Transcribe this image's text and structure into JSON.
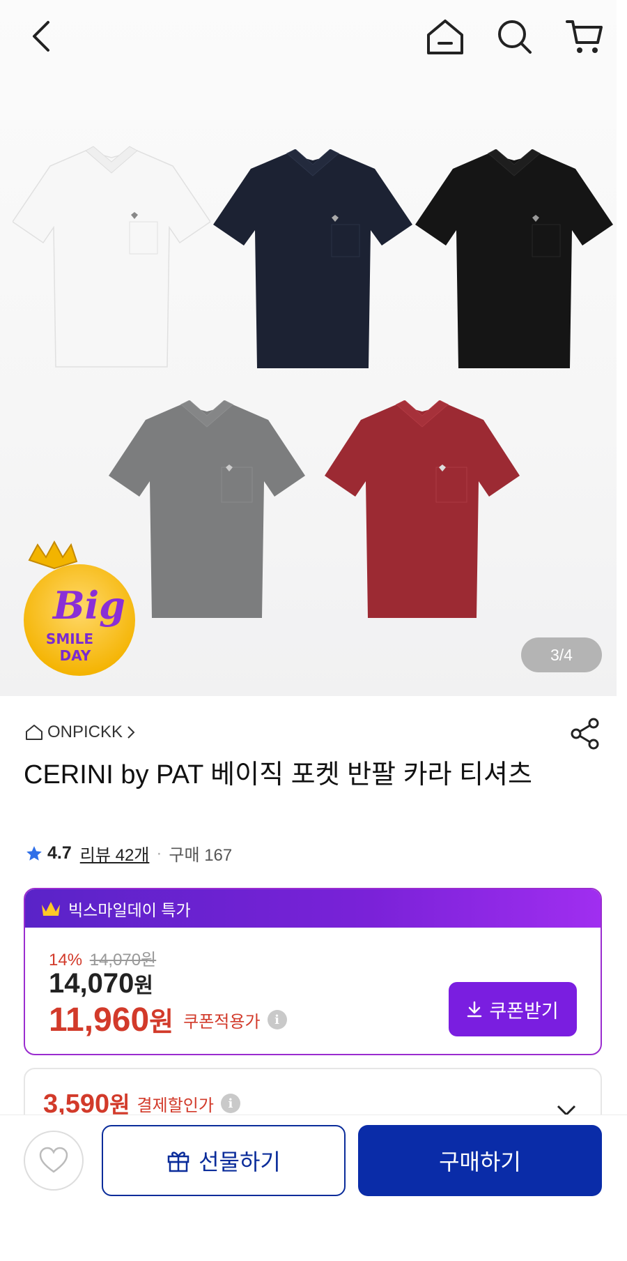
{
  "header": {
    "back_icon": "chevron-left-icon",
    "home_icon": "home-icon",
    "search_icon": "search-icon",
    "cart_icon": "cart-icon"
  },
  "gallery": {
    "page_indicator": "3/4",
    "current_page": 3,
    "total_pages": 4,
    "promo_badge": {
      "line1": "Big",
      "line2": "SMILE",
      "line3": "DAY"
    },
    "shirt_colors": [
      "#f7f7f7",
      "#1c2233",
      "#151515",
      "#7c7d7e",
      "#9c2a33"
    ]
  },
  "product": {
    "seller": "ONPICKK",
    "title": "CERINI by PAT 베이직 포켓 반팔 카라 티셔츠",
    "rating": "4.7",
    "reviews_label": "리뷰 42개",
    "sales_label": "구매 167"
  },
  "deal": {
    "header_label": "빅스마일데이 특가",
    "discount_pct": "14%",
    "original_price": "14,070원",
    "price": "14,070",
    "price_unit": "원",
    "coupon_price": "11,960",
    "coupon_unit": "원",
    "coupon_label": "쿠폰적용가",
    "coupon_button": "쿠폰받기"
  },
  "payment": {
    "price": "3,590",
    "unit": "원",
    "label": "결제할인가"
  },
  "bottom_bar": {
    "gift_label": "선물하기",
    "buy_label": "구매하기"
  },
  "colors": {
    "deal_purple": "#7a1ee0",
    "price_red": "#d23a2a",
    "buy_blue": "#0a2ca8"
  }
}
